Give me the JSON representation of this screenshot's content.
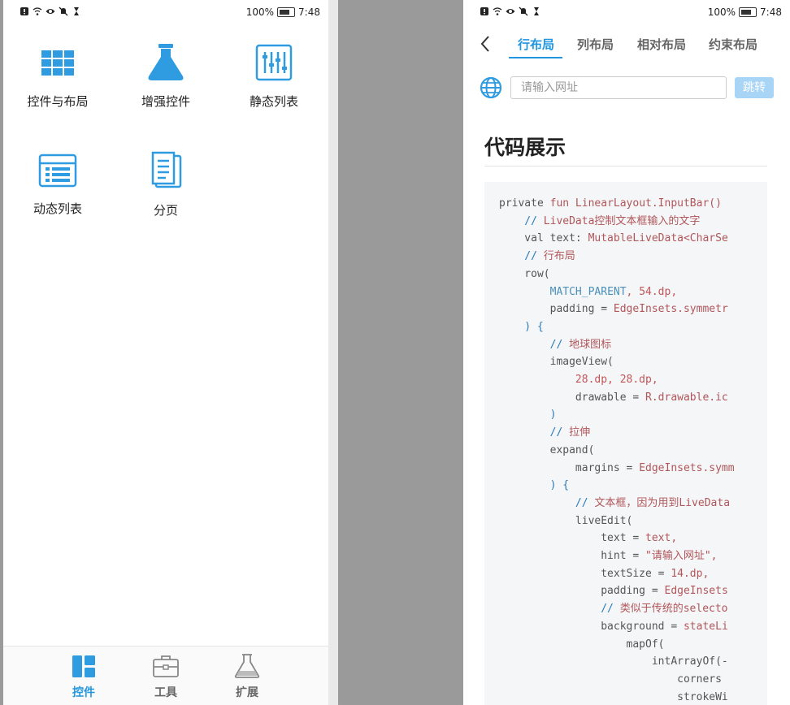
{
  "status_left": {
    "battery_pct": "100%",
    "time": "7:48"
  },
  "status_right": {
    "battery_pct": "100%",
    "time": "7:48"
  },
  "home": {
    "items": [
      {
        "label": "控件与布局",
        "icon": "grid-icon"
      },
      {
        "label": "增强控件",
        "icon": "flask-icon"
      },
      {
        "label": "静态列表",
        "icon": "sliders-list-icon"
      },
      {
        "label": "动态列表",
        "icon": "table-list-icon"
      },
      {
        "label": "分页",
        "icon": "pages-icon"
      }
    ],
    "nav": [
      {
        "label": "控件",
        "icon": "widgets-icon",
        "active": true
      },
      {
        "label": "工具",
        "icon": "toolbox-icon",
        "active": false
      },
      {
        "label": "扩展",
        "icon": "flask-outline-icon",
        "active": false
      }
    ]
  },
  "detail": {
    "tabs": [
      "行布局",
      "列布局",
      "相对布局",
      "约束布局"
    ],
    "active_tab": "行布局",
    "url_placeholder": "请输入网址",
    "go_label": "跳转",
    "section_title": "代码展示",
    "code_lines": [
      "private fun LinearLayout.InputBar()",
      "    // LiveData控制文本框输入的文字",
      "    val text: MutableLiveData<CharSe",
      "    // 行布局",
      "    row(",
      "        MATCH_PARENT, 54.dp,",
      "        padding = EdgeInsets.symmetr",
      "    ) {",
      "        // 地球图标",
      "        imageView(",
      "            28.dp, 28.dp,",
      "            drawable = R.drawable.ic",
      "        )",
      "        // 拉伸",
      "        expand(",
      "            margins = EdgeInsets.symm",
      "        ) {",
      "            // 文本框，因为用到LiveData",
      "            liveEdit(",
      "                text = text,",
      "                hint = \"请输入网址\",",
      "                textSize = 14.dp,",
      "                padding = EdgeInsets",
      "                // 类似于传统的selecto",
      "                background = stateLi",
      "                    mapOf(",
      "                        intArrayOf(-",
      "                            corners",
      "                            strokeWi"
    ]
  },
  "colors": {
    "accent": "#2196e0",
    "button_disabled": "#a8d4f5",
    "code_bg": "#f5f6f8"
  }
}
